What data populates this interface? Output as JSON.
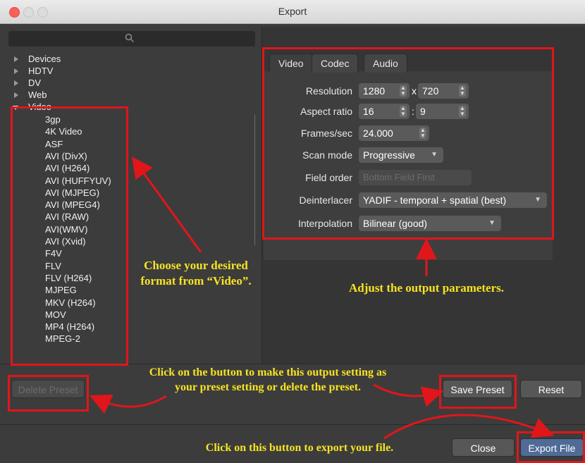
{
  "window": {
    "title": "Export"
  },
  "search": {
    "icon": "search-icon"
  },
  "tree": {
    "categories": [
      {
        "label": "Devices"
      },
      {
        "label": "HDTV"
      },
      {
        "label": "DV"
      },
      {
        "label": "Web"
      },
      {
        "label": "Video"
      }
    ],
    "video_items": [
      {
        "label": "3gp"
      },
      {
        "label": "4K Video"
      },
      {
        "label": "ASF"
      },
      {
        "label": "AVI (DivX)"
      },
      {
        "label": "AVI (H264)"
      },
      {
        "label": "AVI (HUFFYUV)"
      },
      {
        "label": "AVI (MJPEG)"
      },
      {
        "label": "AVI (MPEG4)"
      },
      {
        "label": "AVI (RAW)"
      },
      {
        "label": "AVI(WMV)"
      },
      {
        "label": "AVI (Xvid)"
      },
      {
        "label": "F4V"
      },
      {
        "label": "FLV"
      },
      {
        "label": "FLV (H264)"
      },
      {
        "label": "MJPEG"
      },
      {
        "label": "MKV (H264)"
      },
      {
        "label": "MOV"
      },
      {
        "label": "MP4 (H264)"
      },
      {
        "label": "MPEG-2"
      }
    ]
  },
  "tabs": [
    {
      "label": "Video"
    },
    {
      "label": "Codec"
    },
    {
      "label": "Audio"
    }
  ],
  "video": {
    "resolution_label": "Resolution",
    "resolution_w": "1280",
    "resolution_sep": "x",
    "resolution_h": "720",
    "aspect_label": "Aspect ratio",
    "aspect_w": "16",
    "aspect_sep": ":",
    "aspect_h": "9",
    "fps_label": "Frames/sec",
    "fps": "24.000",
    "scan_label": "Scan mode",
    "scan": "Progressive",
    "field_label": "Field order",
    "field": "Bottom Field First",
    "deint_label": "Deinterlacer",
    "deint": "YADIF - temporal + spatial (best)",
    "interp_label": "Interpolation",
    "interp": "Bilinear (good)"
  },
  "buttons": {
    "delete_preset": "Delete Preset",
    "save_preset": "Save Preset",
    "reset": "Reset",
    "close": "Close",
    "export_file": "Export File"
  },
  "annotations": {
    "choose": "Choose your desired format from “Video”.",
    "adjust": "Adjust the output parameters.",
    "preset": "Click on the button to make this output setting as your preset setting or delete the preset.",
    "export": "Click on this button to export your file."
  },
  "colors": {
    "annotation_text": "#f7e322",
    "annotation_box": "#e0161b"
  }
}
